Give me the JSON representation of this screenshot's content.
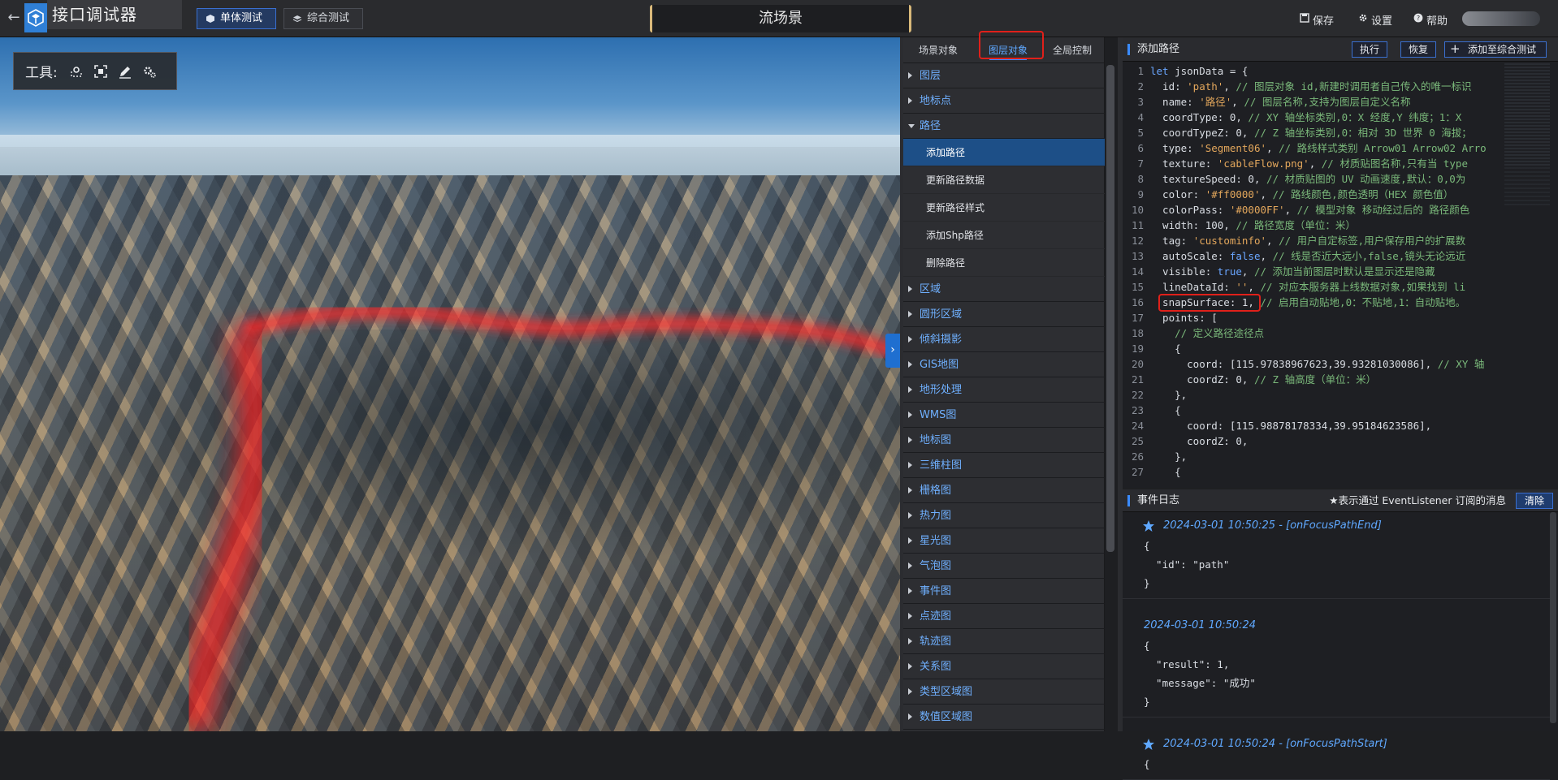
{
  "header": {
    "app_title": "接口调试器",
    "tabs": [
      {
        "label": "单体测试",
        "active": true
      },
      {
        "label": "综合测试",
        "active": false
      }
    ],
    "scene_title": "流场景",
    "actions": {
      "save": "保存",
      "settings": "设置",
      "help": "帮助"
    }
  },
  "viewport": {
    "toolbox_label": "工具:",
    "tools": [
      "location-pin-icon",
      "frame-select-icon",
      "pen-icon",
      "gear-settings-icon"
    ]
  },
  "tree": {
    "tabs": [
      {
        "label": "场景对象",
        "active": false
      },
      {
        "label": "图层对象",
        "active": true
      },
      {
        "label": "全局控制",
        "active": false
      }
    ],
    "nodes": [
      {
        "label": "图层",
        "open": false
      },
      {
        "label": "地标点",
        "open": false
      },
      {
        "label": "路径",
        "open": true,
        "children": [
          "添加路径",
          "更新路径数据",
          "更新路径样式",
          "添加Shp路径",
          "删除路径"
        ],
        "selected": "添加路径"
      },
      {
        "label": "区域",
        "open": false
      },
      {
        "label": "圆形区域",
        "open": false
      },
      {
        "label": "倾斜摄影",
        "open": false
      },
      {
        "label": "GIS地图",
        "open": false
      },
      {
        "label": "地形处理",
        "open": false
      },
      {
        "label": "WMS图",
        "open": false
      },
      {
        "label": "地标图",
        "open": false
      },
      {
        "label": "三维柱图",
        "open": false
      },
      {
        "label": "栅格图",
        "open": false
      },
      {
        "label": "热力图",
        "open": false
      },
      {
        "label": "星光图",
        "open": false
      },
      {
        "label": "气泡图",
        "open": false
      },
      {
        "label": "事件图",
        "open": false
      },
      {
        "label": "点迹图",
        "open": false
      },
      {
        "label": "轨迹图",
        "open": false
      },
      {
        "label": "关系图",
        "open": false
      },
      {
        "label": "类型区域图",
        "open": false
      },
      {
        "label": "数值区域图",
        "open": false
      }
    ]
  },
  "editor": {
    "title": "添加路径",
    "buttons": {
      "run": "执行",
      "restore": "恢复",
      "add_combined": "添加至综合测试"
    },
    "lines": [
      "let jsonData = {",
      "  id: 'path', // 图层对象 id,新建时调用者自己传入的唯一标识",
      "  name: '路径', // 图层名称,支持为图层自定义名称",
      "  coordType: 0, // XY 轴坐标类别,0：X 经度,Y 纬度；1：X",
      "  coordTypeZ: 0, // Z 轴坐标类别,0：相对 3D 世界 0 海拔；",
      "  type: 'Segment06', // 路线样式类别 Arrow01 Arrow02 Arro",
      "  texture: 'cableFlow.png', // 材质贴图名称,只有当 type",
      "  textureSpeed: 0, // 材质贴图的 UV 动画速度,默认：0,0为",
      "  color: '#ff0000', // 路线颜色,颜色透明（HEX 颜色值）",
      "  colorPass: '#0000FF', // 模型对象 移动经过后的 路径颜色",
      "  width: 100, // 路径宽度（单位：米）",
      "  tag: 'custominfo', // 用户自定标签,用户保存用户的扩展数",
      "  autoScale: false, // 线是否近大远小,false,镜头无论远近",
      "  visible: true, // 添加当前图层时默认是显示还是隐藏",
      "  lineDataId: '', // 对应本服务器上线数据对象,如果找到 li",
      "  snapSurface: 1, // 启用自动贴地,0：不贴地,1：自动贴地。",
      "  points: [",
      "    // 定义路径途径点",
      "    {",
      "      coord: [115.97838967623,39.93281030086], // XY 轴",
      "      coordZ: 0, // Z 轴高度（单位：米）",
      "    },",
      "    {",
      "      coord: [115.98878178334,39.95184623586],",
      "      coordZ: 0,",
      "    },",
      "    {"
    ]
  },
  "log": {
    "title": "事件日志",
    "note": "★表示通过 EventListener 订阅的消息",
    "clear": "清除",
    "entries": [
      {
        "starred": true,
        "header": "2024-03-01 10:50:25 - [onFocusPathEnd]",
        "body": "{\n  \"id\": \"path\"\n}"
      },
      {
        "starred": false,
        "header": "2024-03-01 10:50:24",
        "body": "{\n  \"result\": 1,\n  \"message\": \"成功\"\n}"
      },
      {
        "starred": true,
        "header": "2024-03-01 10:50:24 - [onFocusPathStart]",
        "body": "{"
      }
    ]
  }
}
